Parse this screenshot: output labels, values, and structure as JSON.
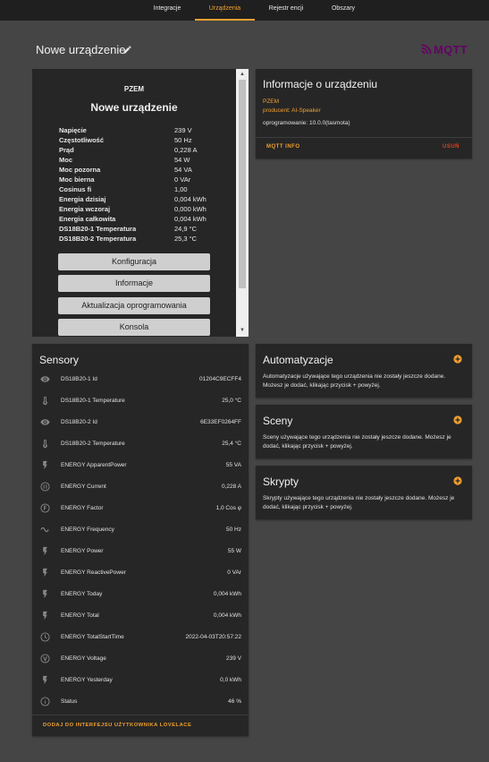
{
  "nav": {
    "tabs": [
      "Integracje",
      "Urządzenia",
      "Rejestr encji",
      "Obszary"
    ]
  },
  "page": {
    "title": "Nowe urządzenie",
    "logo_text": "MQTT"
  },
  "device_card": {
    "model": "PZEM",
    "name": "Nowe urządzenie",
    "rows": [
      {
        "label": "Napięcie",
        "value": "239 V"
      },
      {
        "label": "Częstotliwość",
        "value": "50 Hz"
      },
      {
        "label": "Prąd",
        "value": "0,228 A"
      },
      {
        "label": "Moc",
        "value": "54 W"
      },
      {
        "label": "Moc pozorna",
        "value": "54 VA"
      },
      {
        "label": "Moc bierna",
        "value": "0 VAr"
      },
      {
        "label": "Cosinus fi",
        "value": "1,00"
      },
      {
        "label": "Energia dzisiaj",
        "value": "0,004 kWh"
      },
      {
        "label": "Energia wczoraj",
        "value": "0,000 kWh"
      },
      {
        "label": "Energia całkowita",
        "value": "0,004 kWh"
      },
      {
        "label": "DS18B20-1 Temperatura",
        "value": "24,9 °C"
      },
      {
        "label": "DS18B20-2 Temperatura",
        "value": "25,3 °C"
      }
    ],
    "buttons": [
      "Konfiguracja",
      "Informacje",
      "Aktualizacja oprogramowania",
      "Konsola"
    ]
  },
  "info": {
    "title": "Informacje o urządzeniu",
    "brand": "PZEM",
    "producer": "producent: AI-Speaker",
    "firmware": "oprogramowanie: 10.0.0(tasmota)",
    "mqtt_info": "MQTT INFO",
    "delete": "USUŃ"
  },
  "sensors": {
    "title": "Sensory",
    "items": [
      {
        "icon": "eye-icon",
        "name": "DS18B20-1 Id",
        "value": "01204C9ECFF4"
      },
      {
        "icon": "thermometer-icon",
        "name": "DS18B20-1 Temperature",
        "value": "25,0 °C"
      },
      {
        "icon": "eye-icon",
        "name": "DS18B20-2 Id",
        "value": "6E33EF0264FF"
      },
      {
        "icon": "thermometer-icon",
        "name": "DS18B20-2 Temperature",
        "value": "25,4 °C"
      },
      {
        "icon": "flash-icon",
        "name": "ENERGY ApparentPower",
        "value": "55 VA"
      },
      {
        "icon": "current-icon",
        "name": "ENERGY Current",
        "value": "0,228 A"
      },
      {
        "icon": "factor-icon",
        "name": "ENERGY Factor",
        "value": "1,0 Cos φ"
      },
      {
        "icon": "wave-icon",
        "name": "ENERGY Frequency",
        "value": "50 Hz"
      },
      {
        "icon": "flash-icon",
        "name": "ENERGY Power",
        "value": "55 W"
      },
      {
        "icon": "flash-icon",
        "name": "ENERGY ReactivePower",
        "value": "0 VAr"
      },
      {
        "icon": "flash-icon",
        "name": "ENERGY Today",
        "value": "0,004 kWh"
      },
      {
        "icon": "flash-icon",
        "name": "ENERGY Total",
        "value": "0,004 kWh"
      },
      {
        "icon": "clock-icon",
        "name": "ENERGY TotalStartTime",
        "value": "2022-04-03T20:57:22"
      },
      {
        "icon": "voltage-icon",
        "name": "ENERGY Voltage",
        "value": "239 V"
      },
      {
        "icon": "flash-icon",
        "name": "ENERGY Yesterday",
        "value": "0,0 kWh"
      },
      {
        "icon": "info-icon",
        "name": "Status",
        "value": "46 %"
      }
    ],
    "footer": "DODAJ DO INTERFEJSU UŻYTKOWNIKA LOVELACE"
  },
  "automations": {
    "title": "Automatyzacje",
    "description": "Automatyzacje używające tego urządzenia nie zostały jeszcze dodane. Możesz je dodać, klikając przycisk + powyżej."
  },
  "scenes": {
    "title": "Sceny",
    "description": "Sceny używające tego urządzenia nie zostały jeszcze dodane. Możesz je dodać, klikając przycisk + powyżej."
  },
  "scripts": {
    "title": "Skrypty",
    "description": "Skrypty używające tego urządzenia nie zostały jeszcze dodane. Możesz je dodać, klikając przycisk + powyżej."
  },
  "colors": {
    "accent": "#f0a030",
    "danger": "#e04020",
    "card": "#262626",
    "background": "#454545",
    "mqtt": "#660066"
  }
}
